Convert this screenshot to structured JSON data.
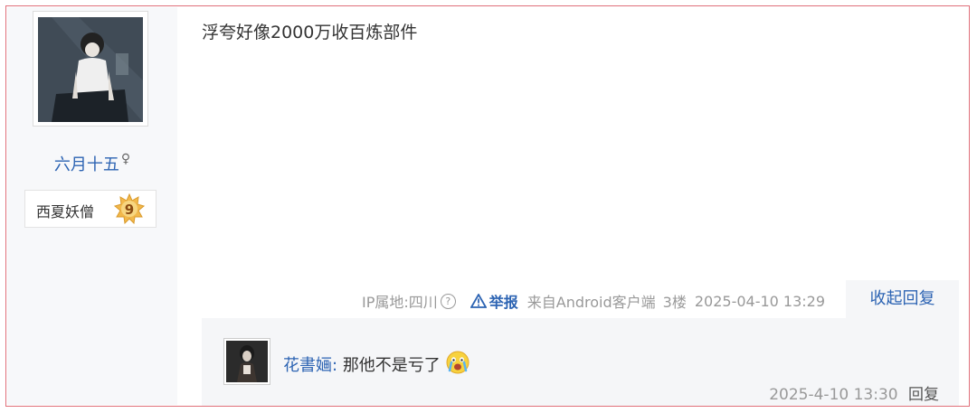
{
  "author": {
    "username": "六月十五",
    "gender_symbol": "♀",
    "rank_title": "西夏妖僧",
    "level": "9"
  },
  "post": {
    "text": "浮夸好像2000万收百炼部件"
  },
  "meta": {
    "ip_label": "IP属地:四川",
    "help_glyph": "?",
    "report_label": "举报",
    "client": "来自Android客户端",
    "floor": "3楼",
    "time": "2025-04-10 13:29",
    "collapse_label": "收起回复"
  },
  "reply": {
    "username": "花書婳:",
    "text": "那他不是亏了",
    "time": "2025-4-10 13:30",
    "reply_label": "回复"
  },
  "colors": {
    "link": "#2d64b3",
    "meta": "#999999",
    "border": "#e0707a",
    "badge": "#f2b84b"
  },
  "icons": [
    "help-icon",
    "warning-icon",
    "crying-emoji-icon",
    "level-badge-icon"
  ]
}
